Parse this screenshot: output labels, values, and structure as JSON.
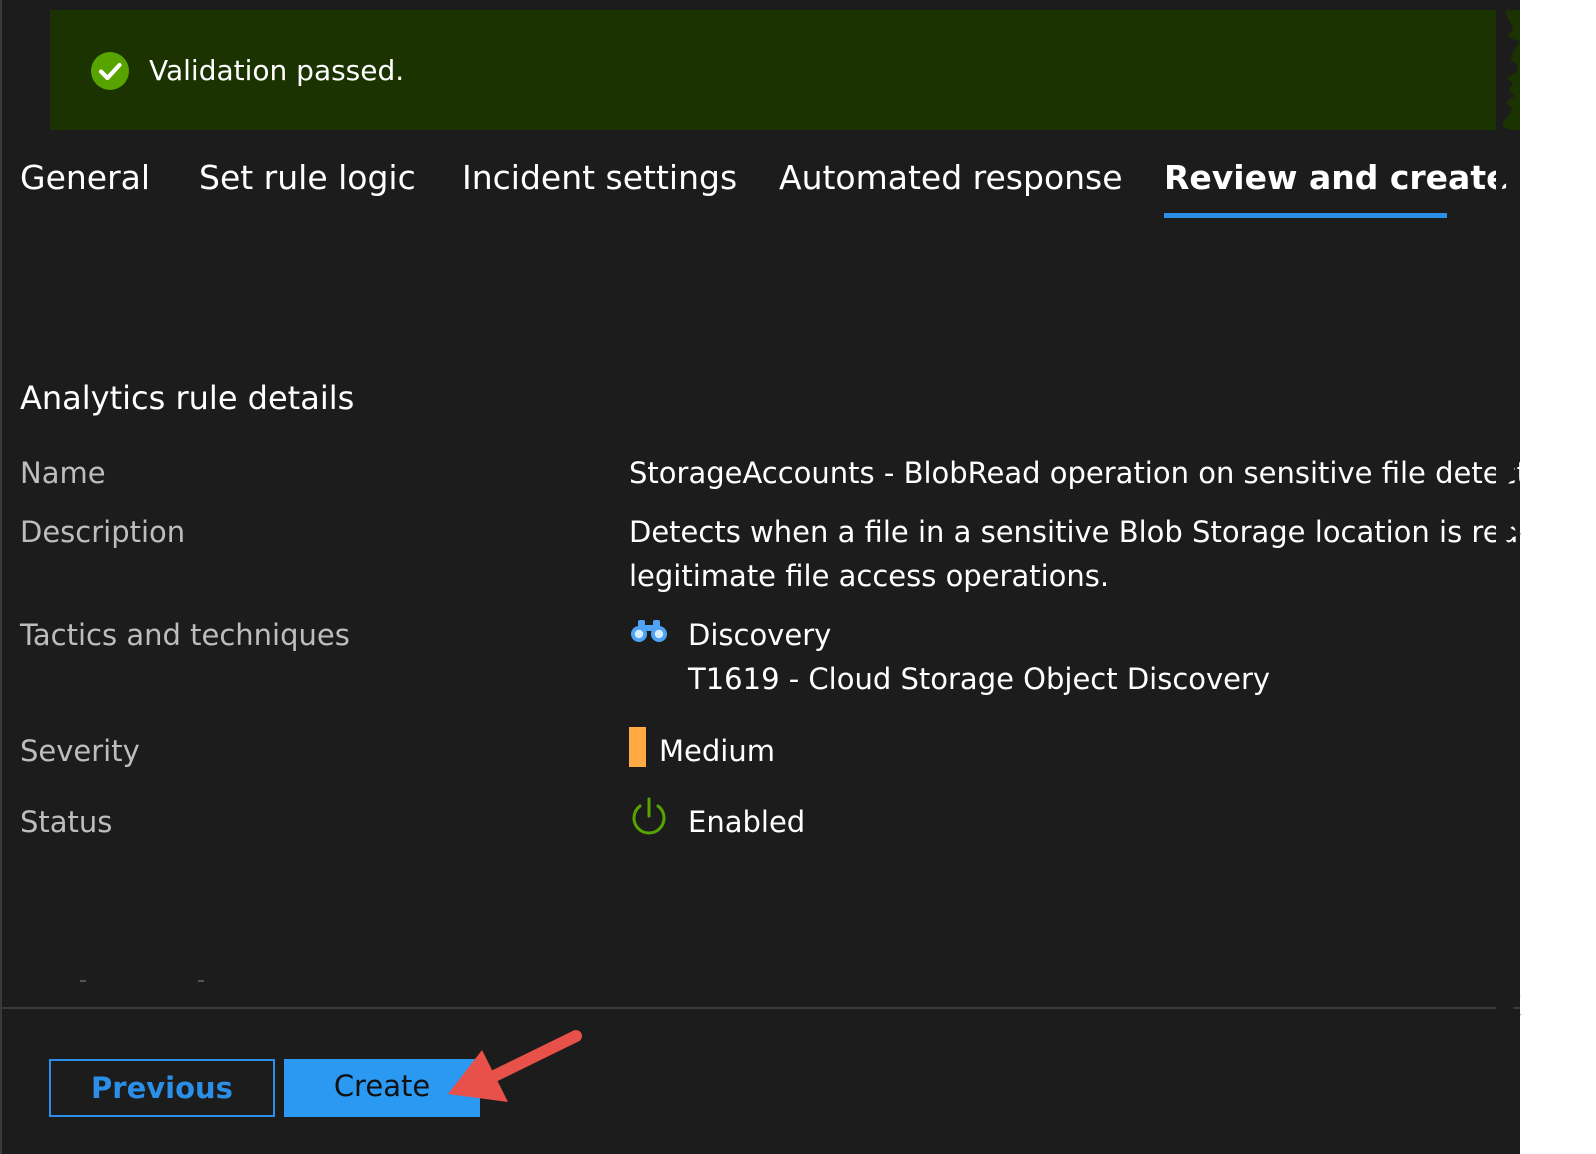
{
  "banner": {
    "message": "Validation passed.",
    "icon": "check-circle-icon",
    "background_color": "#1b3300",
    "icon_color": "#57a300"
  },
  "tabs": [
    {
      "label": "General",
      "active": false
    },
    {
      "label": "Set rule logic",
      "active": false
    },
    {
      "label": "Incident settings",
      "active": false
    },
    {
      "label": "Automated response",
      "active": false
    },
    {
      "label": "Review and create",
      "active": true
    }
  ],
  "details": {
    "title": "Analytics rule details",
    "name": {
      "label": "Name",
      "value": "StorageAccounts - BlobRead operation on sensitive file detecte"
    },
    "description": {
      "label": "Description",
      "line1": "Detects when a file in a sensitive Blob Storage location is read.",
      "line2": "legitimate file access operations."
    },
    "tactics": {
      "label": "Tactics and techniques",
      "tactic": "Discovery",
      "technique": "T1619 - Cloud Storage Object Discovery",
      "icon": "binoculars-icon"
    },
    "severity": {
      "label": "Severity",
      "value": "Medium",
      "color": "#ffaa44"
    },
    "status": {
      "label": "Status",
      "value": "Enabled",
      "icon": "power-icon",
      "icon_color": "#57a300"
    }
  },
  "footer": {
    "previous_label": "Previous",
    "create_label": "Create"
  },
  "colors": {
    "accent": "#2b8fe8",
    "background": "#1c1c1c",
    "annotation_arrow": "#e8504a"
  }
}
